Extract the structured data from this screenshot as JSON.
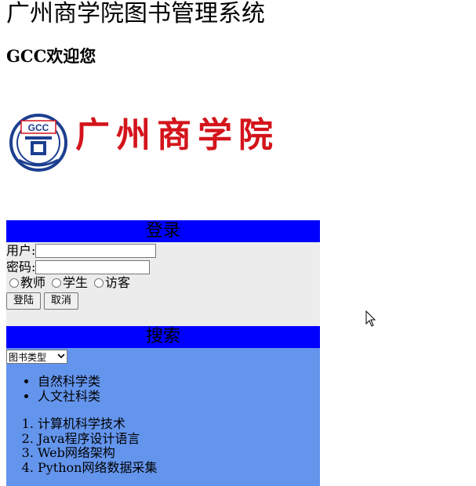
{
  "header": {
    "title": "广州商学院图书管理系统",
    "welcome": "GCC欢迎您"
  },
  "logo": {
    "emblem_text": "GCC",
    "school_name": "广州商学院",
    "brand_color": "#d4141b"
  },
  "login": {
    "heading": "登录",
    "user_label": "用户:",
    "password_label": "密码:",
    "user_value": "",
    "password_value": "",
    "roles": [
      "教师",
      "学生",
      "访客"
    ],
    "login_button": "登陆",
    "cancel_button": "取消",
    "header_color": "#0000ff",
    "body_color": "#ececec"
  },
  "search": {
    "heading": "搜索",
    "select_value": "图书类型",
    "categories": [
      "自然科学类",
      "人文社科类"
    ],
    "books": [
      "计算机科学技术",
      "Java程序设计语言",
      "Web网络架构",
      "Python网络数据采集"
    ],
    "header_color": "#0000ff",
    "body_color": "#6495ed"
  },
  "icons": {
    "cursor": "mouse-pointer-icon",
    "select_arrow": "chevron-down-icon"
  }
}
